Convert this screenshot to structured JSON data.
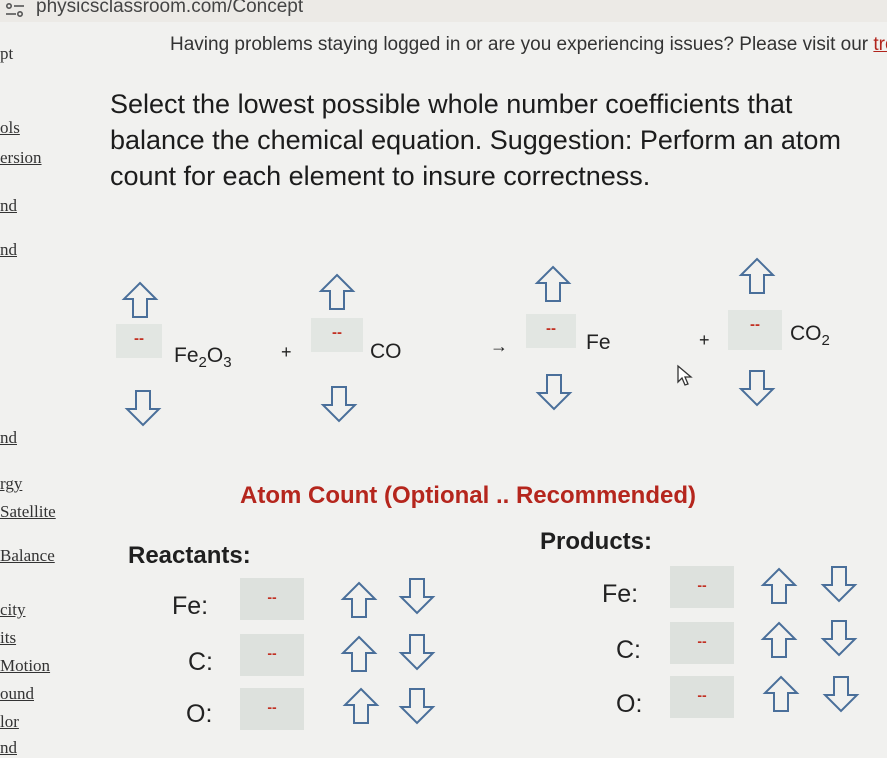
{
  "browser": {
    "url": "physicsclassroom.com/Concept"
  },
  "sidebar": {
    "items": [
      "pt",
      "ols",
      "ersion",
      "nd",
      "nd",
      "nd",
      "rgy",
      "Satellite",
      "Balance",
      "city",
      "its",
      "Motion",
      "ound",
      "lor",
      "nd"
    ]
  },
  "notice": {
    "text": "Having problems staying logged in or are you experiencing issues? Please visit our ",
    "link": "tro"
  },
  "question": {
    "text": "Select the lowest possible whole number coefficients that balance the chemical equation.   Suggestion: Perform an atom count for each element to insure correctness."
  },
  "equation": {
    "reactant1": {
      "coef": "--",
      "formula": "Fe",
      "sub": "2",
      "formula2": "O",
      "sub2": "3"
    },
    "plus1": "+",
    "reactant2": {
      "coef": "--",
      "formula": "CO"
    },
    "arrow": "→",
    "product1": {
      "coef": "--",
      "formula": "Fe"
    },
    "plus2": "+",
    "product2": {
      "coef": "--",
      "formula": "CO",
      "sub": "2"
    }
  },
  "atom_count": {
    "title": "Atom Count (Optional .. Recommended)",
    "reactants_label": "Reactants:",
    "products_label": "Products:",
    "reactants": [
      {
        "element": "Fe:",
        "value": "--"
      },
      {
        "element": "C:",
        "value": "--"
      },
      {
        "element": "O:",
        "value": "--"
      }
    ],
    "products": [
      {
        "element": "Fe:",
        "value": "--"
      },
      {
        "element": "C:",
        "value": "--"
      },
      {
        "element": "O:",
        "value": "--"
      }
    ]
  },
  "icons": {
    "up": "arrow-up-outline-icon",
    "down": "arrow-down-outline-icon"
  },
  "colors": {
    "coefficient_text": "#c23022",
    "title_red": "#b5261d",
    "input_bg": "#dde1dd"
  }
}
